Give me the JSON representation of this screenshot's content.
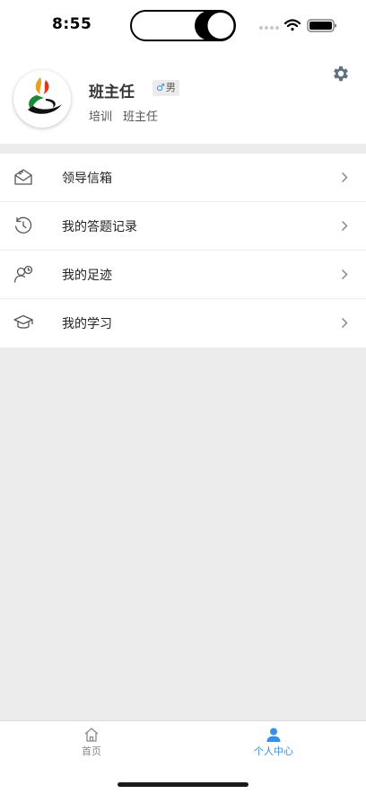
{
  "status_bar": {
    "time": "8:55"
  },
  "profile": {
    "name": "班主任",
    "gender_symbol": "♂",
    "gender": "男",
    "department": "培训",
    "role": "班主任"
  },
  "menu": {
    "items": [
      {
        "label": "领导信箱",
        "icon": "mailbox-icon"
      },
      {
        "label": "我的答题记录",
        "icon": "history-clock-icon"
      },
      {
        "label": "我的足迹",
        "icon": "user-footprint-icon"
      },
      {
        "label": "我的学习",
        "icon": "graduation-cap-icon"
      }
    ]
  },
  "tabbar": {
    "home_label": "首页",
    "me_label": "个人中心",
    "active": "个人中心"
  },
  "colors": {
    "accent": "#3a8ee6",
    "background": "#ececec",
    "surface": "#ffffff"
  }
}
